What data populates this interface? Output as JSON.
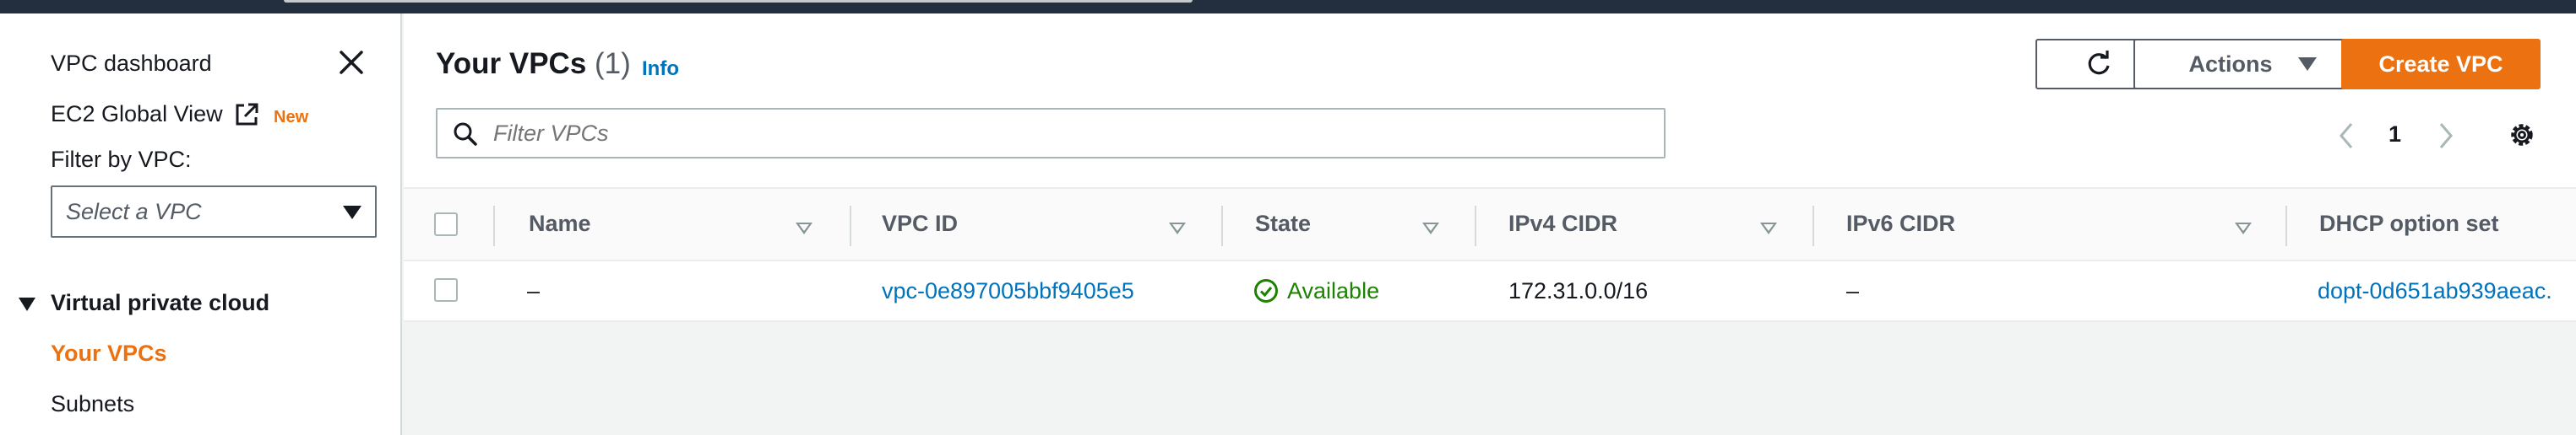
{
  "sidebar": {
    "vpc_dashboard": "VPC dashboard",
    "ec2_global_view": "EC2 Global View",
    "new_badge": "New",
    "filter_label": "Filter by VPC:",
    "filter_placeholder": "Select a VPC",
    "section_title": "Virtual private cloud",
    "items": [
      {
        "label": "Your VPCs",
        "active": true
      },
      {
        "label": "Subnets",
        "active": false
      }
    ]
  },
  "header": {
    "title": "Your VPCs",
    "count": "(1)",
    "info": "Info"
  },
  "toolbar": {
    "actions_label": "Actions",
    "create_label": "Create VPC",
    "filter_placeholder": "Filter VPCs",
    "page_number": "1"
  },
  "table": {
    "columns": [
      "Name",
      "VPC ID",
      "State",
      "IPv4 CIDR",
      "IPv6 CIDR",
      "DHCP option set"
    ],
    "rows": [
      {
        "name": "–",
        "vpc_id": "vpc-0e897005bbf9405e5",
        "state": "Available",
        "ipv4_cidr": "172.31.0.0/16",
        "ipv6_cidr": "–",
        "dhcp_option_set": "dopt-0d651ab939aeac."
      }
    ]
  },
  "colors": {
    "accent": "#ec7211",
    "link": "#0073bb",
    "success": "#1d8102",
    "topbar": "#232f3e"
  },
  "icons": {
    "close": "close-icon",
    "external": "external-link-icon",
    "refresh": "refresh-icon",
    "search": "search-icon",
    "settings": "gear-icon",
    "status": "check-circle-icon"
  }
}
